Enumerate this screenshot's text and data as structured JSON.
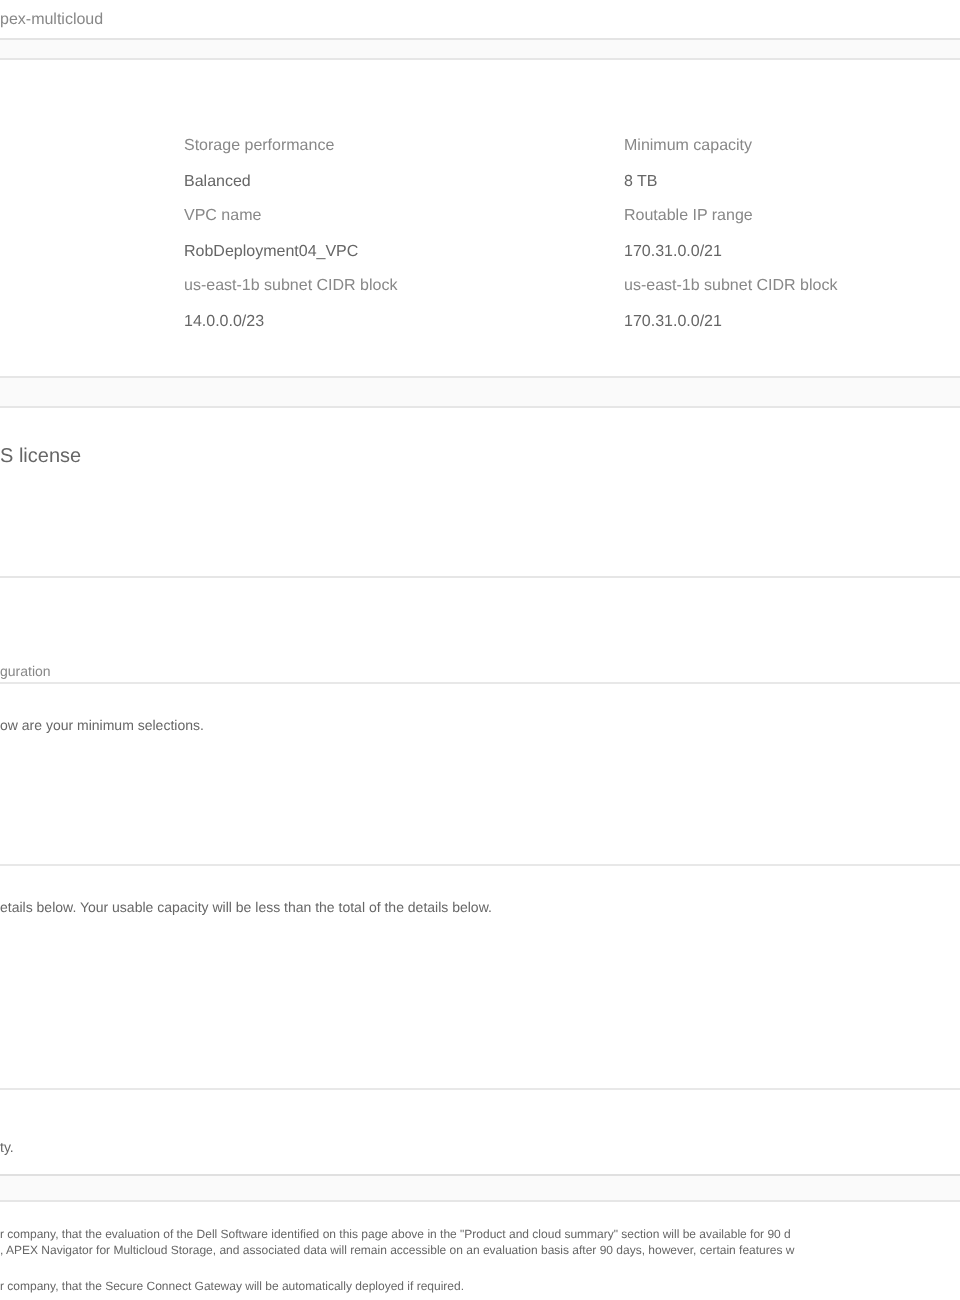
{
  "top_field": {
    "value": "pex-multicloud"
  },
  "summary": {
    "fields": [
      {
        "label": "Storage performance",
        "value": "Balanced"
      },
      {
        "label": "Minimum capacity",
        "value": "8 TB"
      },
      {
        "label": "VPC name",
        "value": "RobDeployment04_VPC"
      },
      {
        "label": "Routable IP range",
        "value": "170.31.0.0/21"
      },
      {
        "label": "us-east-1b subnet CIDR block",
        "value": "14.0.0.0/23"
      },
      {
        "label": "us-east-1b subnet CIDR block",
        "value": "170.31.0.0/21"
      }
    ]
  },
  "license": {
    "heading": "S license"
  },
  "configuration": {
    "heading": "guration",
    "note": "ow are your minimum selections."
  },
  "capacity": {
    "note": "etails below. Your usable capacity will be less than the total of the details below."
  },
  "capacity_end": {
    "note": "ty."
  },
  "terms": [
    "r company, that the evaluation of the Dell Software identified on this page above in the \"Product and cloud summary\" section will be available for 90 d",
    ", APEX Navigator for Multicloud Storage, and associated data will remain accessible on an evaluation basis after 90 days, however, certain features w",
    "r company, that the Secure Connect Gateway will be automatically deployed if required."
  ]
}
